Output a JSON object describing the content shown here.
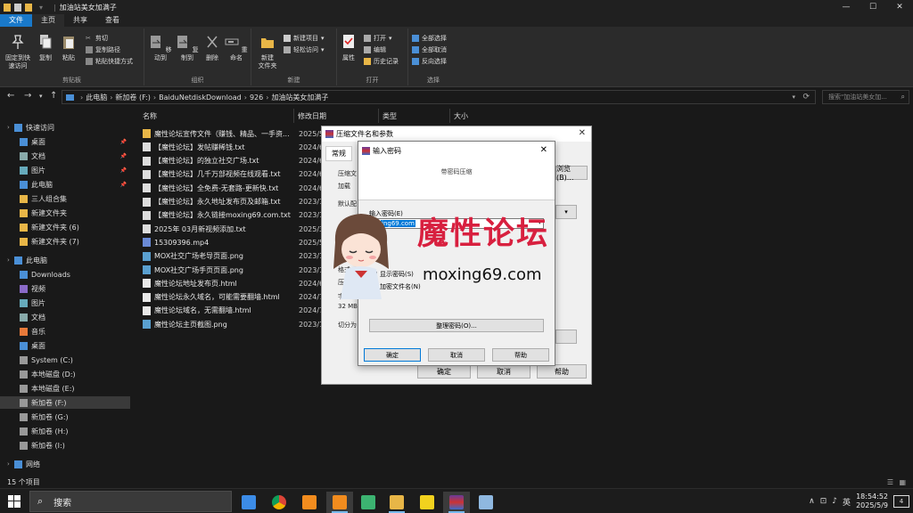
{
  "window": {
    "title": "加油站美女加满子",
    "controls": [
      "—",
      "☐",
      "✕"
    ]
  },
  "ribbon_tabs": [
    "文件",
    "主页",
    "共享",
    "查看"
  ],
  "ribbon": {
    "clipboard": {
      "pin": "固定到快\n速访问",
      "copy": "复制",
      "paste": "粘贴",
      "cut": "剪切",
      "copy_path": "复制路径",
      "paste_shortcut": "粘贴快捷方式",
      "label": "剪贴板"
    },
    "organize": {
      "move_to": "移动到",
      "copy_to": "复制到",
      "delete": "删除",
      "rename": "重命名",
      "label": "组织"
    },
    "new": {
      "new_folder": "新建\n文件夹",
      "new_item": "新建项目",
      "easy_access": "轻松访问",
      "label": "新建"
    },
    "open": {
      "properties": "属性",
      "open": "打开",
      "edit": "编辑",
      "history": "历史记录",
      "label": "打开"
    },
    "select": {
      "select_all": "全部选择",
      "select_none": "全部取消",
      "invert": "反向选择",
      "label": "选择"
    }
  },
  "address": {
    "crumbs": [
      "此电脑",
      "新加卷 (F:)",
      "BaiduNetdiskDownload",
      "926",
      "加油站美女加满子"
    ],
    "search_placeholder": "搜索\"加油站美女加..."
  },
  "sidebar": [
    {
      "label": "快速访问",
      "icon": "star-icon",
      "pinned": false
    },
    {
      "label": "桌面",
      "icon": "desktop-icon",
      "pinned": true
    },
    {
      "label": "文档",
      "icon": "documents-icon",
      "pinned": true
    },
    {
      "label": "图片",
      "icon": "pictures-icon",
      "pinned": true
    },
    {
      "label": "此电脑",
      "icon": "pc-icon",
      "pinned": true
    },
    {
      "label": "三人组合集",
      "icon": "folder-icon",
      "pinned": false
    },
    {
      "label": "新建文件夹",
      "icon": "folder-icon",
      "pinned": false
    },
    {
      "label": "新建文件夹 (6)",
      "icon": "folder-icon",
      "pinned": false
    },
    {
      "label": "新建文件夹 (7)",
      "icon": "folder-icon",
      "pinned": false
    },
    {
      "label": "此电脑",
      "icon": "pc-icon",
      "pinned": false
    },
    {
      "label": "Downloads",
      "icon": "downloads-icon",
      "pinned": false
    },
    {
      "label": "视频",
      "icon": "videos-icon",
      "pinned": false
    },
    {
      "label": "图片",
      "icon": "pictures-icon",
      "pinned": false
    },
    {
      "label": "文档",
      "icon": "documents-icon",
      "pinned": false
    },
    {
      "label": "音乐",
      "icon": "music-icon",
      "pinned": false
    },
    {
      "label": "桌面",
      "icon": "desktop-icon",
      "pinned": false
    },
    {
      "label": "System (C:)",
      "icon": "drive-icon",
      "pinned": false
    },
    {
      "label": "本地磁盘 (D:)",
      "icon": "drive-icon",
      "pinned": false
    },
    {
      "label": "本地磁盘 (E:)",
      "icon": "drive-icon",
      "pinned": false
    },
    {
      "label": "新加卷 (F:)",
      "icon": "drive-icon",
      "pinned": false
    },
    {
      "label": "新加卷 (G:)",
      "icon": "drive-icon",
      "pinned": false
    },
    {
      "label": "新加卷 (H:)",
      "icon": "drive-icon",
      "pinned": false
    },
    {
      "label": "新加卷 (I:)",
      "icon": "drive-icon",
      "pinned": false
    },
    {
      "label": "网络",
      "icon": "network-icon",
      "pinned": false
    }
  ],
  "columns": [
    "名称",
    "修改日期",
    "类型",
    "大小"
  ],
  "files": [
    {
      "name": "魔性论坛宣传文件（赚钱、精品、一手资...",
      "date": "2025/5",
      "icon": "folder-icon"
    },
    {
      "name": "【魔性论坛】发帖赚稀钱.txt",
      "date": "2024/6",
      "icon": "txt-icon"
    },
    {
      "name": "【魔性论坛】的独立社交广场.txt",
      "date": "2024/6",
      "icon": "txt-icon"
    },
    {
      "name": "【魔性论坛】几千万部视频在线观看.txt",
      "date": "2024/6",
      "icon": "txt-icon"
    },
    {
      "name": "【魔性论坛】全免费-无套路-更新快.txt",
      "date": "2024/6",
      "icon": "txt-icon"
    },
    {
      "name": "【魔性论坛】永久地址发布页及邮箱.txt",
      "date": "2023/1",
      "icon": "txt-icon"
    },
    {
      "name": "【魔性论坛】永久链接moxing69.com.txt",
      "date": "2023/1",
      "icon": "txt-icon"
    },
    {
      "name": "2025年 03月新视频添加.txt",
      "date": "2025/3",
      "icon": "txt-icon"
    },
    {
      "name": "15309396.mp4",
      "date": "2025/5",
      "icon": "video-icon"
    },
    {
      "name": "MOX社交广场老导页面.png",
      "date": "2023/1",
      "icon": "image-icon"
    },
    {
      "name": "MOX社交广场手页页面.png",
      "date": "2023/1",
      "icon": "image-icon"
    },
    {
      "name": "魔性论坛地址发布页.html",
      "date": "2024/6",
      "icon": "html-icon"
    },
    {
      "name": "魔性论坛永久域名，可能需要翻墙.html",
      "date": "2024/7",
      "icon": "html-icon"
    },
    {
      "name": "魔性论坛域名，无需翻墙.html",
      "date": "2024/7",
      "icon": "html-icon"
    },
    {
      "name": "魔性论坛主页截图.png",
      "date": "2023/1",
      "icon": "image-icon"
    }
  ],
  "status": {
    "count": "15 个项目"
  },
  "rar_dialog": {
    "title": "压缩文件名和参数",
    "tabs": [
      "常规"
    ],
    "labels": [
      "压缩文",
      "加载",
      "默认配",
      "格式",
      "压缩方",
      "字典大",
      "32 MB",
      "切分为"
    ],
    "browse_btn": "浏览(B)...",
    "ok": "确定",
    "cancel": "取消",
    "help": "帮助"
  },
  "password_dialog": {
    "title": "输入密码",
    "subtitle": "带密码压缩",
    "label": "输入密码(E)",
    "value": "ing69.com",
    "show_password": "显示密码(S)",
    "encrypt_names": "加密文件名(N)",
    "organize": "整理密码(O)...",
    "ok": "确定",
    "cancel": "取消",
    "help": "帮助"
  },
  "watermark": {
    "cn": "魔性论坛",
    "url": "moxing69.com"
  },
  "taskbar": {
    "search": "搜索",
    "time": "18:54:52",
    "date": "2025/5/9",
    "ime": "英",
    "notifications": "4"
  },
  "colors": {
    "accent": "#1979ca",
    "watermark_red": "#d8203f",
    "folder": "#e8b647",
    "dark_bg": "#191919"
  }
}
